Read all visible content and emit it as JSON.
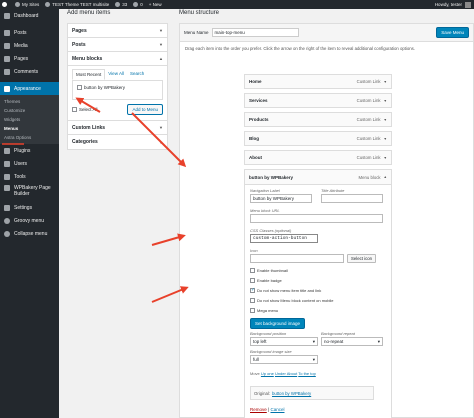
{
  "adminbar": {
    "my_sites": "My Sites",
    "site": "TEST Theme TEST multisite",
    "updates": "33",
    "comments": "0",
    "new": "+ New",
    "howdy": "Howdy, tester"
  },
  "sidebar": {
    "items": [
      {
        "label": "Dashboard",
        "icon": "dashboard-icon"
      },
      {
        "label": "Posts",
        "icon": "pushpin-icon"
      },
      {
        "label": "Media",
        "icon": "media-icon"
      },
      {
        "label": "Pages",
        "icon": "pages-icon"
      },
      {
        "label": "Comments",
        "icon": "comments-icon"
      },
      {
        "label": "Appearance",
        "icon": "appearance-icon"
      }
    ],
    "submenu": [
      "Themes",
      "Customize",
      "Widgets",
      "Menus",
      "Astra Options"
    ],
    "items_after": [
      {
        "label": "Plugins",
        "icon": "plugins-icon"
      },
      {
        "label": "Users",
        "icon": "users-icon"
      },
      {
        "label": "Tools",
        "icon": "tools-icon"
      },
      {
        "label": "WPBakery Page Builder",
        "icon": "wpbakery-icon"
      },
      {
        "label": "Settings",
        "icon": "settings-icon"
      },
      {
        "label": "Groovy menu",
        "icon": "groovy-icon"
      },
      {
        "label": "Collapse menu",
        "icon": "collapse-icon"
      }
    ]
  },
  "left": {
    "title": "Add menu items",
    "sections": [
      "Pages",
      "Posts",
      "Menu blocks",
      "Custom Links",
      "Categories"
    ],
    "tabs": [
      "Most Recent",
      "View All",
      "Search"
    ],
    "item_label": "button by WPBakery",
    "select_all": "Select All",
    "add_button": "Add to Menu"
  },
  "right": {
    "title": "Menu structure",
    "menu_name_label": "Menu Name",
    "menu_name_value": "main-top-menu",
    "save_button": "Save Menu",
    "instruction": "Drag each item into the order you prefer. Click the arrow on the right of the item to reveal additional configuration options.",
    "items": [
      {
        "title": "Home",
        "type": "Custom Link"
      },
      {
        "title": "Services",
        "type": "Custom Link"
      },
      {
        "title": "Products",
        "type": "Custom Link"
      },
      {
        "title": "Blog",
        "type": "Custom Link"
      },
      {
        "title": "About",
        "type": "Custom Link"
      }
    ],
    "expanded": {
      "title": "button by WPBakery",
      "type": "Menu block",
      "nav_label_label": "Navigation Label",
      "nav_label_value": "button by WPBakery",
      "title_attr_label": "Title Attribute",
      "url_label": "Menu block URL",
      "css_label": "CSS Classes (optional)",
      "css_value": "custom-action-button",
      "icon_label": "Icon",
      "select_icon": "Select icon",
      "enable_thumbnail": "Enable thumbnail",
      "enable_badge": "Enable badge",
      "hide_title": "Do not show menu item title and link",
      "hide_content": "Do not show Menu block content on mobile",
      "mega_menu": "Mega menu",
      "set_bg": "Set background image",
      "bg_position_label": "Background position",
      "bg_position_value": "top left",
      "bg_repeat_label": "Background repeat",
      "bg_repeat_value": "no-repeat",
      "bg_size_label": "Background image size",
      "bg_size_value": "full",
      "move_label": "Move",
      "move_up": "Up one",
      "move_under": "Under About",
      "move_top": "To the top",
      "original_label": "Original:",
      "original_link": "button by WPBakery",
      "remove": "Remove",
      "separator": "|",
      "cancel": "Cancel"
    }
  },
  "colors": {
    "accent": "#0073aa",
    "arrow": "#e8412b",
    "menu_bg": "#23282d"
  }
}
